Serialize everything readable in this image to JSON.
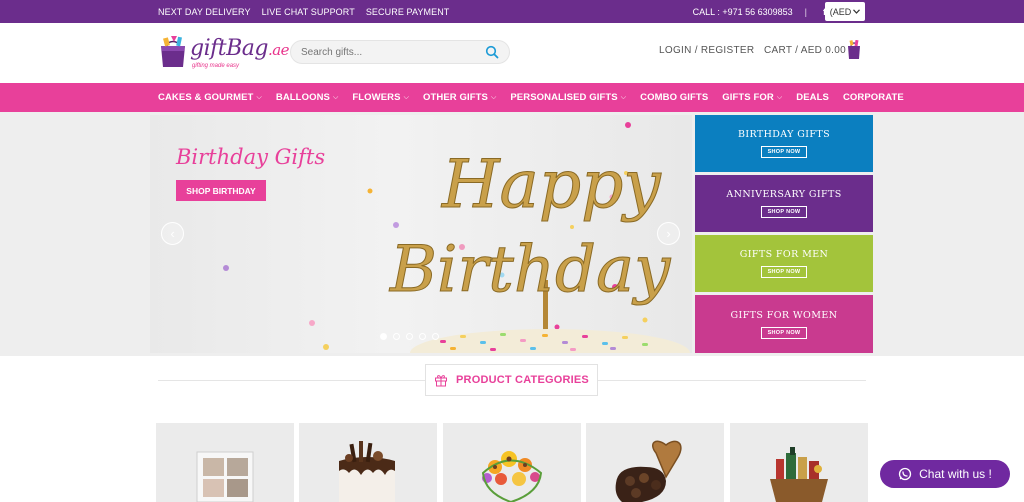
{
  "topbar": {
    "links": [
      "NEXT DAY DELIVERY",
      "LIVE CHAT SUPPORT",
      "SECURE PAYMENT"
    ],
    "call": "CALL : +971 56 6309853",
    "divider": "|",
    "currency": "(AED"
  },
  "header": {
    "logo_main": "giftBag",
    "logo_suffix": ".ae",
    "logo_tagline": "gifting made easy",
    "search_placeholder": "Search gifts...",
    "login": "LOGIN / REGISTER",
    "cart": "CART / AED 0.00"
  },
  "nav": {
    "items": [
      {
        "label": "CAKES & GOURMET",
        "chevron": "⌵"
      },
      {
        "label": "BALLOONS",
        "chevron": "⌵"
      },
      {
        "label": "FLOWERS",
        "chevron": "⌵"
      },
      {
        "label": "OTHER GIFTS",
        "chevron": "⌵"
      },
      {
        "label": "PERSONALISED GIFTS",
        "chevron": "⌵"
      },
      {
        "label": "COMBO GIFTS",
        "chevron": ""
      },
      {
        "label": "GIFTS FOR",
        "chevron": "⌵"
      },
      {
        "label": "DEALS",
        "chevron": ""
      },
      {
        "label": "CORPORATE",
        "chevron": ""
      }
    ]
  },
  "hero": {
    "title": "Birthday Gifts",
    "button": "SHOP BIRTHDAY",
    "topper_line1": "Happy",
    "topper_line2": "Birthday",
    "prev": "‹",
    "next": "›",
    "dots": 5,
    "active_dot": 1
  },
  "side_banners": [
    {
      "title": "BIRTHDAY GIFTS",
      "button": "SHOP NOW",
      "color": "#0b7fc0"
    },
    {
      "title": "ANNIVERSARY GIFTS",
      "button": "SHOP NOW",
      "color": "#6b2d8c"
    },
    {
      "title": "GIFTS FOR MEN",
      "button": "SHOP NOW",
      "color": "#a3c43b"
    },
    {
      "title": "GIFTS FOR WOMEN",
      "button": "SHOP NOW",
      "color": "#c93a8f"
    }
  ],
  "categories_title": "PRODUCT CATEGORIES",
  "chat": {
    "label": "Chat with us !"
  },
  "colors": {
    "purple": "#6b2d8c",
    "pink": "#e8409a",
    "chat": "#7029a0"
  }
}
